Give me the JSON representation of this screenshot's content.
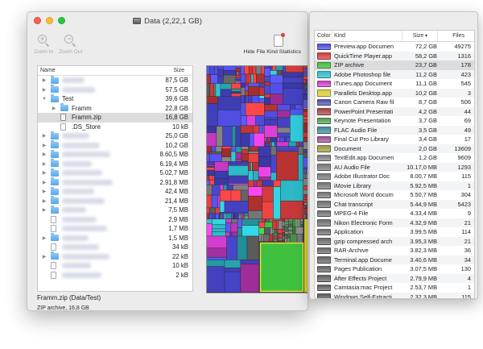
{
  "window": {
    "title": "Data (2,22,1 GB)"
  },
  "toolbar": {
    "zoom_in_label": "Zoom In",
    "zoom_out_label": "Zoom Out",
    "hide_stats_label": "Hide File Kind Statistics",
    "zoom_in_icon": "zoom-in-icon",
    "zoom_out_icon": "zoom-out-icon",
    "hide_stats_icon": "document-icon"
  },
  "tree": {
    "col_name": "Name",
    "col_size": "Size",
    "rows": [
      {
        "name": "",
        "size": "87,5 GB",
        "depth": 0,
        "expanded": false,
        "icon": "folder",
        "blurred": true
      },
      {
        "name": "",
        "size": "57,5 GB",
        "depth": 0,
        "expanded": false,
        "icon": "folder",
        "blurred": true
      },
      {
        "name": "Test",
        "size": "39,6 GB",
        "depth": 0,
        "expanded": true,
        "icon": "folder",
        "blurred": false
      },
      {
        "name": "Framm",
        "size": "22,8 GB",
        "depth": 1,
        "expanded": false,
        "icon": "folder",
        "blurred": false
      },
      {
        "name": "Framm.zip",
        "size": "16,8 GB",
        "depth": 1,
        "expanded": null,
        "icon": "zip",
        "blurred": false,
        "selected": true
      },
      {
        "name": ".DS_Store",
        "size": "10 kB",
        "depth": 1,
        "expanded": null,
        "icon": "file",
        "blurred": false
      },
      {
        "name": "",
        "size": "25,0 GB",
        "depth": 0,
        "expanded": false,
        "icon": "folder",
        "blurred": true
      },
      {
        "name": "",
        "size": "10,2 GB",
        "depth": 0,
        "expanded": false,
        "icon": "folder",
        "blurred": true
      },
      {
        "name": "",
        "size": "8.60,5 MB",
        "depth": 0,
        "expanded": false,
        "icon": "folder",
        "blurred": true
      },
      {
        "name": "",
        "size": "6.19,4 MB",
        "depth": 0,
        "expanded": false,
        "icon": "folder",
        "blurred": true
      },
      {
        "name": "",
        "size": "5.02,7 MB",
        "depth": 0,
        "expanded": false,
        "icon": "folder",
        "blurred": true
      },
      {
        "name": "",
        "size": "2.91,8 MB",
        "depth": 0,
        "expanded": false,
        "icon": "folder",
        "blurred": true
      },
      {
        "name": "",
        "size": "42,4 MB",
        "depth": 0,
        "expanded": false,
        "icon": "folder",
        "blurred": true
      },
      {
        "name": "",
        "size": "21,4 MB",
        "depth": 0,
        "expanded": false,
        "icon": "folder",
        "blurred": true
      },
      {
        "name": "",
        "size": "7,5 MB",
        "depth": 0,
        "expanded": false,
        "icon": "folder",
        "blurred": true
      },
      {
        "name": "",
        "size": "2,9 MB",
        "depth": 0,
        "expanded": null,
        "icon": "file",
        "blurred": true
      },
      {
        "name": "",
        "size": "1,7 MB",
        "depth": 0,
        "expanded": null,
        "icon": "file",
        "blurred": true
      },
      {
        "name": "",
        "size": "1,5 MB",
        "depth": 0,
        "expanded": false,
        "icon": "folder",
        "blurred": true
      },
      {
        "name": "",
        "size": "34 kB",
        "depth": 0,
        "expanded": null,
        "icon": "file",
        "blurred": true
      },
      {
        "name": "",
        "size": "22 kB",
        "depth": 0,
        "expanded": false,
        "icon": "folder",
        "blurred": true
      },
      {
        "name": "",
        "size": "10 kB",
        "depth": 0,
        "expanded": null,
        "icon": "file",
        "blurred": true
      },
      {
        "name": "",
        "size": "2 kB",
        "depth": 0,
        "expanded": null,
        "icon": "file",
        "blurred": true
      }
    ]
  },
  "selection": {
    "path": "Framm.zip (Data/Test)",
    "info": "ZIP archive, 16,8 GB"
  },
  "kind_stats": {
    "col_color": "Color",
    "col_kind": "Kind",
    "col_size": "Size",
    "col_files": "Files",
    "rows": [
      {
        "kind": "Preview.app Documen",
        "size": "72,2 GB",
        "files": "49275",
        "color": "#4b49d6"
      },
      {
        "kind": "QuickTime Player.app",
        "size": "58,2 GB",
        "files": "1316",
        "color": "#d23a3a"
      },
      {
        "kind": "ZIP archive",
        "size": "23,7 GB",
        "files": "178",
        "color": "#3fc13f",
        "selected": true
      },
      {
        "kind": "Adobe Photoshop file",
        "size": "11,2 GB",
        "files": "423",
        "color": "#2dbbc9"
      },
      {
        "kind": "iTunes.app Document",
        "size": "11,1 GB",
        "files": "545",
        "color": "#c93ac4"
      },
      {
        "kind": "Parallels Desktop.app",
        "size": "10,2 GB",
        "files": "3",
        "color": "#d7d12b"
      },
      {
        "kind": "Canon Camera Raw fil",
        "size": "8,7 GB",
        "files": "506",
        "color": "#4a4ea5"
      },
      {
        "kind": "PowerPoint Presentati",
        "size": "4,2 GB",
        "files": "44",
        "color": "#a94040"
      },
      {
        "kind": "Keynote Presentation",
        "size": "3,7 GB",
        "files": "69",
        "color": "#4f9a4f"
      },
      {
        "kind": "FLAC Audio File",
        "size": "3,5 GB",
        "files": "49",
        "color": "#3c8a9a"
      },
      {
        "kind": "Final Cut Pro Library",
        "size": "3,4 GB",
        "files": "17",
        "color": "#9a4a9a"
      },
      {
        "kind": "Document",
        "size": "2,0 GB",
        "files": "13609",
        "color": "#9a9a3e"
      },
      {
        "kind": "TextEdit.app Documen",
        "size": "1,2 GB",
        "files": "9609",
        "color": "#7a7a7a"
      },
      {
        "kind": "AU Audio File",
        "size": "10.17,0 MB",
        "files": "1293",
        "color": "#787878"
      },
      {
        "kind": "Adobe Illustrator Doc",
        "size": "8.00,7 MB",
        "files": "115",
        "color": "#767676"
      },
      {
        "kind": "iMovie Library",
        "size": "5.92,5 MB",
        "files": "1",
        "color": "#747474"
      },
      {
        "kind": "Microsoft Word docum",
        "size": "5.50,7 MB",
        "files": "304",
        "color": "#727272"
      },
      {
        "kind": "Chat transcript",
        "size": "5.44,9 MB",
        "files": "5423",
        "color": "#707070"
      },
      {
        "kind": "MPEG-4 File",
        "size": "4.33,4 MB",
        "files": "9",
        "color": "#6e6e6e"
      },
      {
        "kind": "Nikon Electronic Form",
        "size": "4.32,9 MB",
        "files": "21",
        "color": "#6c6c6c"
      },
      {
        "kind": "Application",
        "size": "3.99,5 MB",
        "files": "114",
        "color": "#6a6a6a"
      },
      {
        "kind": "gzip compressed arch",
        "size": "3.95,3 MB",
        "files": "21",
        "color": "#686868"
      },
      {
        "kind": "RAR-Archive",
        "size": "3.82,3 MB",
        "files": "36",
        "color": "#666666"
      },
      {
        "kind": "Terminal.app Docume",
        "size": "3.40,6 MB",
        "files": "34",
        "color": "#646464"
      },
      {
        "kind": "Pages Publication",
        "size": "3.07,5 MB",
        "files": "130",
        "color": "#626262"
      },
      {
        "kind": "After Effects Project",
        "size": "2.79,9 MB",
        "files": "4",
        "color": "#606060"
      },
      {
        "kind": "Camtasia:mac Project",
        "size": "2.53,7 MB",
        "files": "1",
        "color": "#5e5e5e"
      },
      {
        "kind": "Windows Self-Extracti",
        "size": "2.32,3 MB",
        "files": "115",
        "color": "#5c5c5c"
      }
    ]
  },
  "treemap": {
    "highlight_color": "#e8e23a",
    "palette": [
      "#4b49d6",
      "#d23a3a",
      "#3fc13f",
      "#2dbbc9",
      "#c93ac4",
      "#d7d12b",
      "#4a4ea5",
      "#a94040",
      "#4f9a4f",
      "#777777"
    ]
  }
}
